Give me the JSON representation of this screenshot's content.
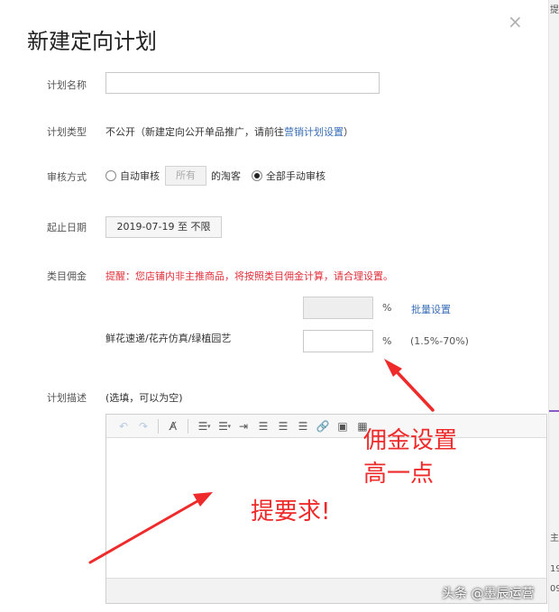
{
  "dialog": {
    "title": "新建定向计划",
    "close_glyph": "×"
  },
  "form": {
    "plan_name": {
      "label": "计划名称",
      "value": "",
      "placeholder": ""
    },
    "plan_type": {
      "label": "计划类型",
      "text_prefix": "不公开（新建定向公开单品推广，请前往",
      "link": "营销计划设置",
      "text_suffix": "）"
    },
    "audit": {
      "label": "审核方式",
      "auto_option": "自动审核",
      "all_box": "所有",
      "after_box": "的淘客",
      "manual_option": "全部手动审核",
      "selected": "全部手动审核"
    },
    "date": {
      "label": "起止日期",
      "value": "2019-07-19 至 不限"
    },
    "commission": {
      "label": "类目佣金",
      "notice": "提醒：您店铺内非主推商品，将按照类目佣金计算，请合理设置。",
      "batch_percent": "%",
      "batch_link": "批量设置",
      "category": "鲜花速递/花卉仿真/绿植园艺",
      "rate_value": "",
      "rate_percent": "%",
      "rate_range": "(1.5%-70%)"
    },
    "description": {
      "label": "计划描述",
      "hint": "(选填，可以为空)",
      "toolbar": {
        "undo": "↶",
        "redo": "↷",
        "format_clear": "A̸",
        "unordered_list": "☰",
        "ordered_list": "☰",
        "indent": "⇥",
        "align_left": "☰",
        "align_center": "☰",
        "align_right": "☰",
        "link": "🔗",
        "image": "▣",
        "table": "▦",
        "caret": "▾"
      }
    }
  },
  "annotations": {
    "line1": "佣金设置",
    "line2": "高一点",
    "line3": "提要求!"
  },
  "watermark": "头条 @墨辰运营",
  "right_strip": {
    "t1": "提",
    "t2": "主",
    "t3": "19",
    "t4": "09"
  },
  "colors": {
    "annotation_red": "#ee2a2a",
    "link_blue": "#3a6fb8",
    "notice_red": "#e0303a"
  }
}
